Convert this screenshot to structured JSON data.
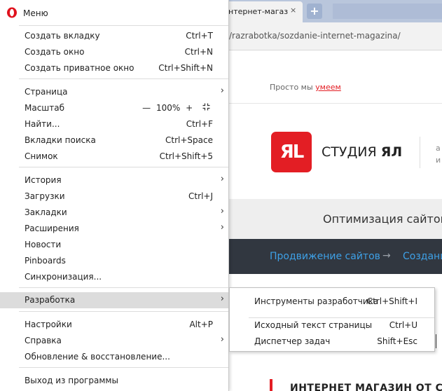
{
  "browser": {
    "active_tab_title": "нтернет-магаз",
    "tab_close": "×",
    "new_tab": "+",
    "url": "/razrabotka/sozdanie-internet-magazina/"
  },
  "site": {
    "tagline_prefix": "Просто мы ",
    "tagline_link": "умеем",
    "logo_mark": "ЯL",
    "logo_name_prefix": "СТУДИЯ ",
    "logo_name_bold": "ЯЛ",
    "logo_side_1": "а",
    "logo_side_2": "и",
    "grey_band_text": "Оптимизация сайтов",
    "nav_link_1": "Продвижение сайтов",
    "nav_arrow": "→",
    "nav_link_2": "Создани",
    "heading_cut": "ИНТЕРНЕТ МАГАЗИН ОТ СТ",
    "colors": {
      "brand_red": "#e31e24",
      "dark_band": "#313740",
      "link_blue": "#3ea0e6"
    }
  },
  "menu": {
    "title": "Меню",
    "items": [
      {
        "label": "Создать вкладку",
        "shortcut": "Ctrl+T"
      },
      {
        "label": "Создать окно",
        "shortcut": "Ctrl+N"
      },
      {
        "label": "Создать приватное окно",
        "shortcut": "Ctrl+Shift+N"
      },
      {
        "label": "Страница",
        "shortcut": "",
        "arrow": "›"
      },
      {
        "label": "Масштаб",
        "zoom_minus": "—",
        "zoom_value": "100%",
        "zoom_plus": "+",
        "fullscreen_icon": "fullscreen-icon"
      },
      {
        "label": "Найти...",
        "shortcut": "Ctrl+F"
      },
      {
        "label": "Вкладки поиска",
        "shortcut": "Ctrl+Space"
      },
      {
        "label": "Снимок",
        "shortcut": "Ctrl+Shift+5"
      },
      {
        "label": "История",
        "shortcut": "",
        "arrow": "›"
      },
      {
        "label": "Загрузки",
        "shortcut": "Ctrl+J"
      },
      {
        "label": "Закладки",
        "shortcut": "",
        "arrow": "›"
      },
      {
        "label": "Расширения",
        "shortcut": "",
        "arrow": "›"
      },
      {
        "label": "Новости",
        "shortcut": ""
      },
      {
        "label": "Pinboards",
        "shortcut": ""
      },
      {
        "label": "Синхронизация...",
        "shortcut": ""
      },
      {
        "label": "Разработка",
        "shortcut": "",
        "arrow": "›",
        "active": true
      },
      {
        "label": "Настройки",
        "shortcut": "Alt+P"
      },
      {
        "label": "Справка",
        "shortcut": "",
        "arrow": "›"
      },
      {
        "label": "Обновление & восстановление...",
        "shortcut": ""
      },
      {
        "label": "Выход из программы",
        "shortcut": ""
      }
    ]
  },
  "developer_submenu": {
    "items": [
      {
        "label": "Инструменты разработчика",
        "shortcut": "Ctrl+Shift+I"
      },
      {
        "label": "Исходный текст страницы",
        "shortcut": "Ctrl+U"
      },
      {
        "label": "Диспетчер задач",
        "shortcut": "Shift+Esc"
      }
    ]
  }
}
